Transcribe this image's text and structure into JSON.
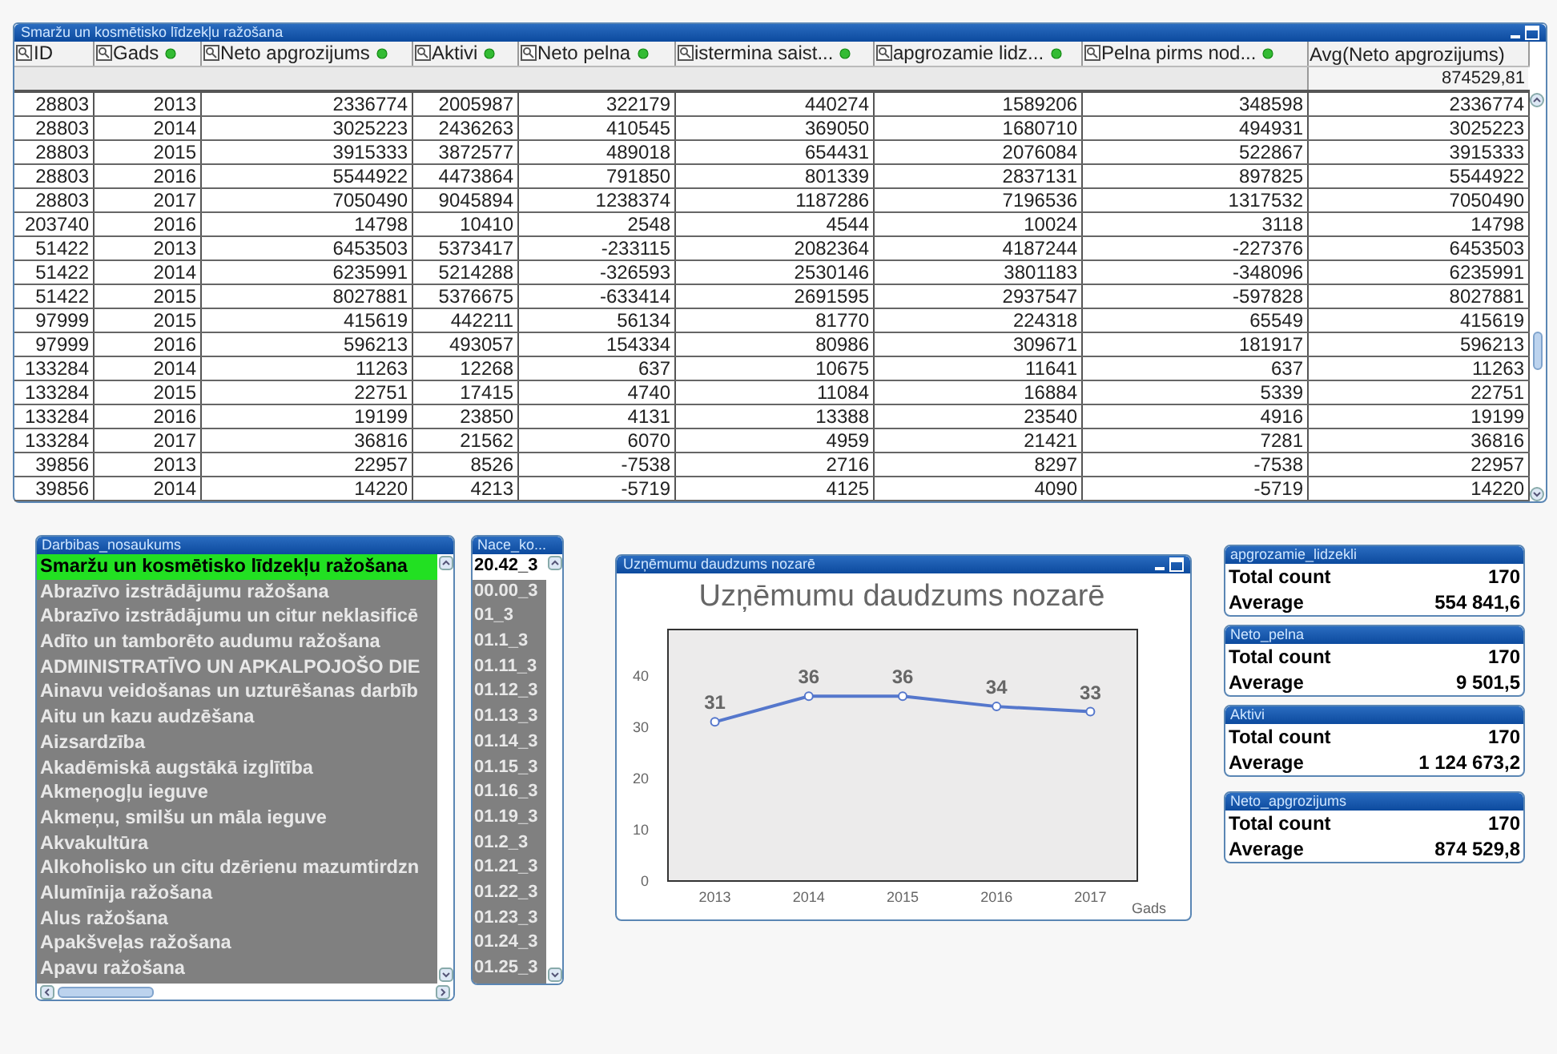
{
  "table": {
    "title": "Smaržu un kosmētisko līdzekļu ražošana",
    "columns": [
      {
        "label": "ID",
        "search": true,
        "marked": false
      },
      {
        "label": "Gads",
        "search": true,
        "marked": true
      },
      {
        "label": "Neto  apgrozijums",
        "search": true,
        "marked": true
      },
      {
        "label": "Aktivi",
        "search": true,
        "marked": true
      },
      {
        "label": "Neto  pelna",
        "search": true,
        "marked": true
      },
      {
        "label": "istermina  saist...",
        "search": true,
        "marked": true
      },
      {
        "label": "apgrozamie  lidz...",
        "search": true,
        "marked": true
      },
      {
        "label": "Pelna  pirms  nod...",
        "search": true,
        "marked": true
      },
      {
        "label": "Avg(Neto  apgrozijums)",
        "search": false,
        "marked": false,
        "total": "874529,81"
      }
    ],
    "rows": [
      [
        "28803",
        "2013",
        "2336774",
        "2005987",
        "322179",
        "440274",
        "1589206",
        "348598",
        "2336774"
      ],
      [
        "28803",
        "2014",
        "3025223",
        "2436263",
        "410545",
        "369050",
        "1680710",
        "494931",
        "3025223"
      ],
      [
        "28803",
        "2015",
        "3915333",
        "3872577",
        "489018",
        "654431",
        "2076084",
        "522867",
        "3915333"
      ],
      [
        "28803",
        "2016",
        "5544922",
        "4473864",
        "791850",
        "801339",
        "2837131",
        "897825",
        "5544922"
      ],
      [
        "28803",
        "2017",
        "7050490",
        "9045894",
        "1238374",
        "1187286",
        "7196536",
        "1317532",
        "7050490"
      ],
      [
        "203740",
        "2016",
        "14798",
        "10410",
        "2548",
        "4544",
        "10024",
        "3118",
        "14798"
      ],
      [
        "51422",
        "2013",
        "6453503",
        "5373417",
        "-233115",
        "2082364",
        "4187244",
        "-227376",
        "6453503"
      ],
      [
        "51422",
        "2014",
        "6235991",
        "5214288",
        "-326593",
        "2530146",
        "3801183",
        "-348096",
        "6235991"
      ],
      [
        "51422",
        "2015",
        "8027881",
        "5376675",
        "-633414",
        "2691595",
        "2937547",
        "-597828",
        "8027881"
      ],
      [
        "97999",
        "2015",
        "415619",
        "442211",
        "56134",
        "81770",
        "224318",
        "65549",
        "415619"
      ],
      [
        "97999",
        "2016",
        "596213",
        "493057",
        "154334",
        "80986",
        "309671",
        "181917",
        "596213"
      ],
      [
        "133284",
        "2014",
        "11263",
        "12268",
        "637",
        "10675",
        "11641",
        "637",
        "11263"
      ],
      [
        "133284",
        "2015",
        "22751",
        "17415",
        "4740",
        "11084",
        "16884",
        "5339",
        "22751"
      ],
      [
        "133284",
        "2016",
        "19199",
        "23850",
        "4131",
        "13388",
        "23540",
        "4916",
        "19199"
      ],
      [
        "133284",
        "2017",
        "36816",
        "21562",
        "6070",
        "4959",
        "21421",
        "7281",
        "36816"
      ],
      [
        "39856",
        "2013",
        "22957",
        "8526",
        "-7538",
        "2716",
        "8297",
        "-7538",
        "22957"
      ],
      [
        "39856",
        "2014",
        "14220",
        "4213",
        "-5719",
        "4125",
        "4090",
        "-5719",
        "14220"
      ]
    ]
  },
  "activity_list": {
    "title": "Darbibas_nosaukums",
    "items": [
      {
        "label": "Smaržu un kosmētisko līdzekļu ražošana",
        "selected": true
      },
      {
        "label": "Abrazīvo izstrādājumu ražošana",
        "selected": false
      },
      {
        "label": "Abrazīvo izstrādājumu un citur neklasificē",
        "selected": false
      },
      {
        "label": "Adīto un tamborēto audumu ražošana",
        "selected": false
      },
      {
        "label": "ADMINISTRATĪVO UN APKALPOJOŠO DIE",
        "selected": false
      },
      {
        "label": "Ainavu veidošanas un uzturēšanas darbīb",
        "selected": false
      },
      {
        "label": "Aitu un kazu audzēšana",
        "selected": false
      },
      {
        "label": "Aizsardzība",
        "selected": false
      },
      {
        "label": "Akadēmiskā augstākā izglītība",
        "selected": false
      },
      {
        "label": "Akmeņogļu ieguve",
        "selected": false
      },
      {
        "label": "Akmeņu, smilšu un māla ieguve",
        "selected": false
      },
      {
        "label": "Akvakultūra",
        "selected": false
      },
      {
        "label": "Alkoholisko un citu dzērienu mazumtirdzn",
        "selected": false
      },
      {
        "label": "Alumīnija ražošana",
        "selected": false
      },
      {
        "label": "Alus ražošana",
        "selected": false
      },
      {
        "label": "Apakšveļas ražošana",
        "selected": false
      },
      {
        "label": "Apavu ražošana",
        "selected": false
      }
    ]
  },
  "nace_list": {
    "title": "Nace_ko...",
    "items": [
      {
        "label": "20.42_3",
        "selected": true
      },
      {
        "label": "00.00_3",
        "selected": false
      },
      {
        "label": "01_3",
        "selected": false
      },
      {
        "label": "01.1_3",
        "selected": false
      },
      {
        "label": "01.11_3",
        "selected": false
      },
      {
        "label": "01.12_3",
        "selected": false
      },
      {
        "label": "01.13_3",
        "selected": false
      },
      {
        "label": "01.14_3",
        "selected": false
      },
      {
        "label": "01.15_3",
        "selected": false
      },
      {
        "label": "01.16_3",
        "selected": false
      },
      {
        "label": "01.19_3",
        "selected": false
      },
      {
        "label": "01.2_3",
        "selected": false
      },
      {
        "label": "01.21_3",
        "selected": false
      },
      {
        "label": "01.22_3",
        "selected": false
      },
      {
        "label": "01.23_3",
        "selected": false
      },
      {
        "label": "01.24_3",
        "selected": false
      },
      {
        "label": "01.25_3",
        "selected": false
      }
    ]
  },
  "chart_window": {
    "title": "Uzņēmumu daudzums nozarē",
    "chart_data": {
      "type": "line",
      "title": "Uzņēmumu daudzums nozarē",
      "xlabel": "Gads",
      "categories": [
        "2013",
        "2014",
        "2015",
        "2016",
        "2017"
      ],
      "series": [
        {
          "color": "#5577cc",
          "marker": "circle",
          "values": [
            31,
            36,
            36,
            34,
            33
          ]
        }
      ],
      "ylim": [
        0,
        49
      ],
      "yticks": [
        0,
        10,
        20,
        30,
        40
      ],
      "data_labels": true
    }
  },
  "stat_boxes": [
    {
      "title": "apgrozamie_lidzekli",
      "rows": [
        {
          "label": "Total count",
          "value": "170"
        },
        {
          "label": "Average",
          "value": "554 841,6"
        }
      ]
    },
    {
      "title": "Neto_pelna",
      "rows": [
        {
          "label": "Total count",
          "value": "170"
        },
        {
          "label": "Average",
          "value": "9 501,5"
        }
      ]
    },
    {
      "title": "Aktivi",
      "rows": [
        {
          "label": "Total count",
          "value": "170"
        },
        {
          "label": "Average",
          "value": "1 124 673,2"
        }
      ]
    },
    {
      "title": "Neto_apgrozijums",
      "rows": [
        {
          "label": "Total count",
          "value": "170"
        },
        {
          "label": "Average",
          "value": "874 529,8"
        }
      ]
    }
  ]
}
